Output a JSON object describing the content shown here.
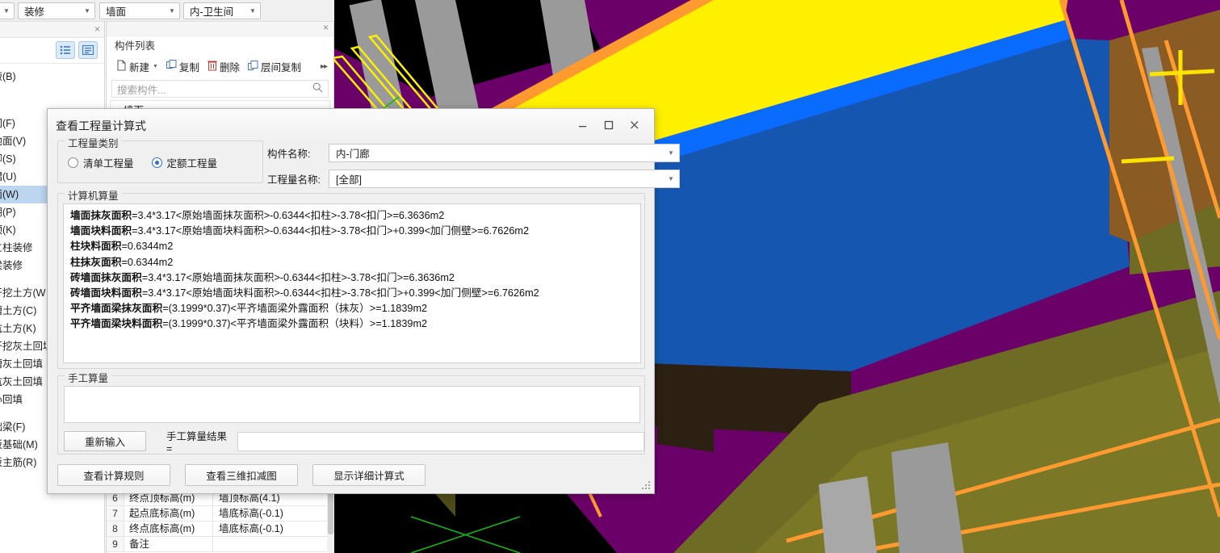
{
  "topbar": {
    "dropdowns": [
      {
        "name": "category-select",
        "value": ""
      },
      {
        "name": "discipline-select",
        "value": "装修"
      },
      {
        "name": "element-select",
        "value": "墙面"
      },
      {
        "name": "room-select",
        "value": "内-卫生间"
      }
    ]
  },
  "left_panel": {
    "close_label": "×",
    "view_icons": [
      "list-view-icon",
      "detail-view-icon"
    ],
    "nav_groups": [
      {
        "items": [
          "加腋(B)"
        ]
      },
      {
        "items": [
          "房间(F)",
          "楼地面(V)",
          "踢脚(S)",
          "墙裙(U)",
          "墙面(W)",
          "天棚(P)",
          "吊顶(K)",
          "独立柱装修",
          "单梁装修"
        ],
        "selected": "墙面(W)"
      },
      {
        "items": [
          "大开挖土方(W",
          "沟槽土方(C)",
          "基坑土方(K)",
          "大开挖灰土回填",
          "沟槽灰土回填",
          "基坑灰土回填",
          "房心回填"
        ]
      },
      {
        "items": [
          "基础梁(F)",
          "筏板基础(M)",
          "筏板主筋(R)"
        ]
      }
    ]
  },
  "component_list": {
    "close_label": "×",
    "title": "构件列表",
    "toolbar": [
      {
        "name": "new-button",
        "label": "新建",
        "icon": "new-file-icon",
        "has_caret": true
      },
      {
        "name": "copy-button",
        "label": "复制",
        "icon": "copy-icon",
        "has_caret": false
      },
      {
        "name": "delete-button",
        "label": "删除",
        "icon": "trash-icon",
        "has_caret": false
      },
      {
        "name": "layer-copy-button",
        "label": "层间复制",
        "icon": "layer-copy-icon",
        "has_caret": false
      }
    ],
    "more_label": "▸▸",
    "search_placeholder": "搜索构件...",
    "search_value": "",
    "tree": [
      {
        "label": "墙面",
        "expanded": true
      }
    ]
  },
  "property_table": {
    "rows": [
      {
        "index": "6",
        "name": "终点顶标高(m)",
        "value": "墙顶标高(4.1)"
      },
      {
        "index": "7",
        "name": "起点底标高(m)",
        "value": "墙底标高(-0.1)"
      },
      {
        "index": "8",
        "name": "终点底标高(m)",
        "value": "墙底标高(-0.1)"
      },
      {
        "index": "9",
        "name": "备注",
        "value": ""
      }
    ]
  },
  "dialog": {
    "title": "查看工程量计算式",
    "window_buttons": [
      {
        "name": "minimize-button",
        "icon": "minimize-icon"
      },
      {
        "name": "maximize-button",
        "icon": "maximize-icon"
      },
      {
        "name": "close-button",
        "icon": "close-icon"
      }
    ],
    "category_group": {
      "legend": "工程量类别",
      "options": [
        {
          "label": "清单工程量",
          "checked": false
        },
        {
          "label": "定额工程量",
          "checked": true
        }
      ]
    },
    "fields": [
      {
        "name": "component-name-select",
        "label": "构件名称:",
        "value": "内-门廊"
      },
      {
        "name": "quantity-name-select",
        "label": "工程量名称:",
        "value": "[全部]"
      }
    ],
    "auto_group": {
      "legend": "计算机算量",
      "formulas": [
        {
          "label": "墙面抹灰面积",
          "expr": "=3.4*3.17<原始墙面抹灰面积>-0.6344<扣柱>-3.78<扣门>=6.3636m2"
        },
        {
          "label": "墙面块料面积",
          "expr": "=3.4*3.17<原始墙面块料面积>-0.6344<扣柱>-3.78<扣门>+0.399<加门侧壁>=6.7626m2"
        },
        {
          "label": "柱块料面积",
          "expr": "=0.6344m2"
        },
        {
          "label": "柱抹灰面积",
          "expr": "=0.6344m2"
        },
        {
          "label": "砖墙面抹灰面积",
          "expr": "=3.4*3.17<原始墙面抹灰面积>-0.6344<扣柱>-3.78<扣门>=6.3636m2"
        },
        {
          "label": "砖墙面块料面积",
          "expr": "=3.4*3.17<原始墙面块料面积>-0.6344<扣柱>-3.78<扣门>+0.399<加门侧壁>=6.7626m2"
        },
        {
          "label": "平齐墙面梁抹灰面积",
          "expr": "=(3.1999*0.37)<平齐墙面梁外露面积（抹灰）>=1.1839m2"
        },
        {
          "label": "平齐墙面梁块料面积",
          "expr": "=(3.1999*0.37)<平齐墙面梁外露面积（块料）>=1.1839m2"
        }
      ]
    },
    "manual_group": {
      "legend": "手工算量",
      "textarea_value": "",
      "reinput_label": "重新输入",
      "result_label": "手工算量结果=",
      "result_value": ""
    },
    "footer_buttons": [
      {
        "name": "view-rules-button",
        "label": "查看计算规则"
      },
      {
        "name": "view-3d-deduct-button",
        "label": "查看三维扣减图"
      },
      {
        "name": "show-detail-button",
        "label": "显示详细计算式"
      }
    ],
    "resize_grip": "resize-grip-icon"
  },
  "viewport": {
    "name": "3d-model-viewport",
    "colors": {
      "background": "#000000",
      "floor_purple": "#6B0069",
      "highlight_yellow": "#FFF000",
      "highlight_blue": "#1557B0",
      "outline_orange": "#FF9A30",
      "wall_olive": "#82802B",
      "wall_brown": "#8A5B22",
      "column_gray": "#9A9A9A",
      "dark_brown": "#2C2013",
      "axis_green": "#14B814"
    }
  }
}
